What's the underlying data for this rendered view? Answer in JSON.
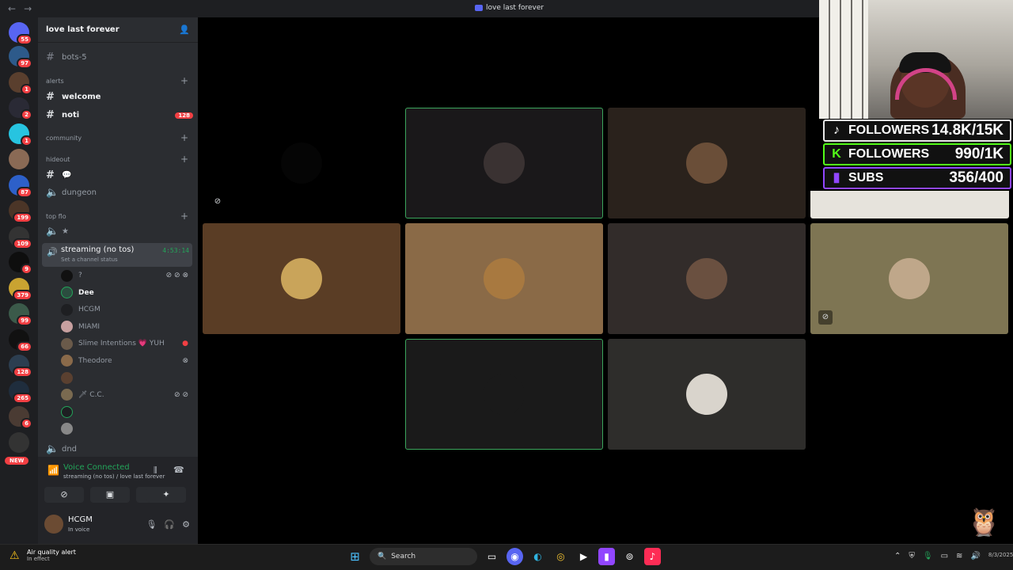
{
  "window": {
    "title": "love last forever",
    "back_glyph": "←",
    "forward_glyph": "→"
  },
  "guilds": {
    "home_badge": "55",
    "items": [
      {
        "badge": "97",
        "color": "#2d5a8a"
      },
      {
        "badge": "1",
        "color": "#5a3f2e"
      },
      {
        "badge": "2",
        "color": "#2a2a35"
      },
      {
        "badge": "1",
        "color": "#27c4e0"
      },
      {
        "badge": "",
        "color": "#8a6a55"
      },
      {
        "badge": "87",
        "color": "#2d60c9"
      },
      {
        "badge": "199",
        "color": "#4b3527"
      },
      {
        "badge": "109",
        "color": "#333"
      },
      {
        "badge": "9",
        "color": "#0e0e0e"
      },
      {
        "badge": "379",
        "color": "#c9a331"
      },
      {
        "badge": "99",
        "color": "#3b5a4a"
      },
      {
        "badge": "66",
        "color": "#111"
      },
      {
        "badge": "128",
        "color": "#2c3e50"
      },
      {
        "badge": "265",
        "color": "#1f2d3d"
      },
      {
        "badge": "6",
        "color": "#4a3b33"
      },
      {
        "badge": "",
        "color": "#333"
      }
    ],
    "new_label": "NEW"
  },
  "server": {
    "name": "love last forever",
    "channels": {
      "bots": "bots-5",
      "cat_alerts": "alerts",
      "welcome": "welcome",
      "noti": "noti",
      "noti_count": "128",
      "cat_community": "community",
      "cat_hideout": "hideout",
      "speech_glyph": "💬",
      "dungeon": "dungeon",
      "cat_topflo": "top flo",
      "star": "★",
      "streaming": "streaming (no tos)",
      "streaming_status": "Set a channel status",
      "streaming_time": "4:53:14",
      "dnd": "dnd"
    },
    "members": [
      {
        "name": "?",
        "right": "⊘ ⊘ ⊗",
        "avatar": "#111"
      },
      {
        "name": "Dee",
        "right": "",
        "avatar": "#2b4d3f"
      },
      {
        "name": "HCGM",
        "right": "",
        "avatar": "#1e1f22"
      },
      {
        "name": "MIAMI",
        "right": "",
        "avatar": "#c8a0a0"
      },
      {
        "name": "Slime Intentions 💗 YUH",
        "right": "●",
        "avatar": "#6a5a4a"
      },
      {
        "name": "Theodore",
        "right": "⊗",
        "avatar": "#8a6a4a"
      },
      {
        "name": "",
        "right": "",
        "avatar": "#5a4030"
      },
      {
        "name": "🗡 C.C.",
        "right": "⊘ ⊘",
        "avatar": "#7a6a50"
      },
      {
        "name": "",
        "right": "",
        "avatar": "#1e1f22"
      },
      {
        "name": "",
        "right": "",
        "avatar": "#888"
      }
    ]
  },
  "voice_panel": {
    "status": "Voice Connected",
    "location": "streaming (no tos) / love last forever",
    "buttons": [
      "⊘",
      "▣",
      "✚",
      "✦"
    ]
  },
  "user_panel": {
    "name": "HCGM",
    "status": "In voice",
    "mic_glyph": "🎙",
    "headset_glyph": "🎧",
    "gear_glyph": "⚙"
  },
  "stream_overlay": {
    "stats": [
      {
        "icon": "♪",
        "label": "FOLLOWERS",
        "value": "14.8K/15K",
        "border": "#e7e7e7",
        "icon_color": "#ffffff"
      },
      {
        "icon": "K",
        "label": "FOLLOWERS",
        "value": "990/1K",
        "border": "#53fc18",
        "icon_color": "#53fc18"
      },
      {
        "icon": "▮",
        "label": "SUBS",
        "value": "356/400",
        "border": "#9146ff",
        "icon_color": "#9146ff"
      }
    ],
    "owl_glyph": "🦉"
  },
  "taskbar": {
    "alert_title": "Air quality alert",
    "alert_sub": "In effect",
    "search_placeholder": "Search",
    "tray_clock": "8/3/2025"
  },
  "tiles": [
    {
      "bg": "#000000",
      "avatar": "#050505",
      "speaking": false,
      "muted": true
    },
    {
      "bg": "#1a181a",
      "avatar": "#3a3232",
      "speaking": true,
      "muted": false
    },
    {
      "bg": "#2a221c",
      "avatar": "#6a4e38",
      "speaking": false,
      "muted": false
    },
    {
      "bg": "#5a3d25",
      "avatar": "#c9a45a",
      "speaking": false,
      "muted": false
    },
    {
      "bg": "#8a6a47",
      "avatar": "#a87940",
      "speaking": false,
      "muted": false
    },
    {
      "bg": "#322c2a",
      "avatar": "#6a5040",
      "speaking": false,
      "muted": false
    },
    {
      "bg": "#7e7553",
      "avatar": "#bfa78a",
      "speaking": false,
      "muted": true
    },
    {
      "bg": "#1a1a1a",
      "avatar": "#1a1a1a",
      "speaking": true,
      "muted": false
    },
    {
      "bg": "#2e2d2b",
      "avatar": "#d9d4cc",
      "speaking": false,
      "muted": false
    }
  ]
}
